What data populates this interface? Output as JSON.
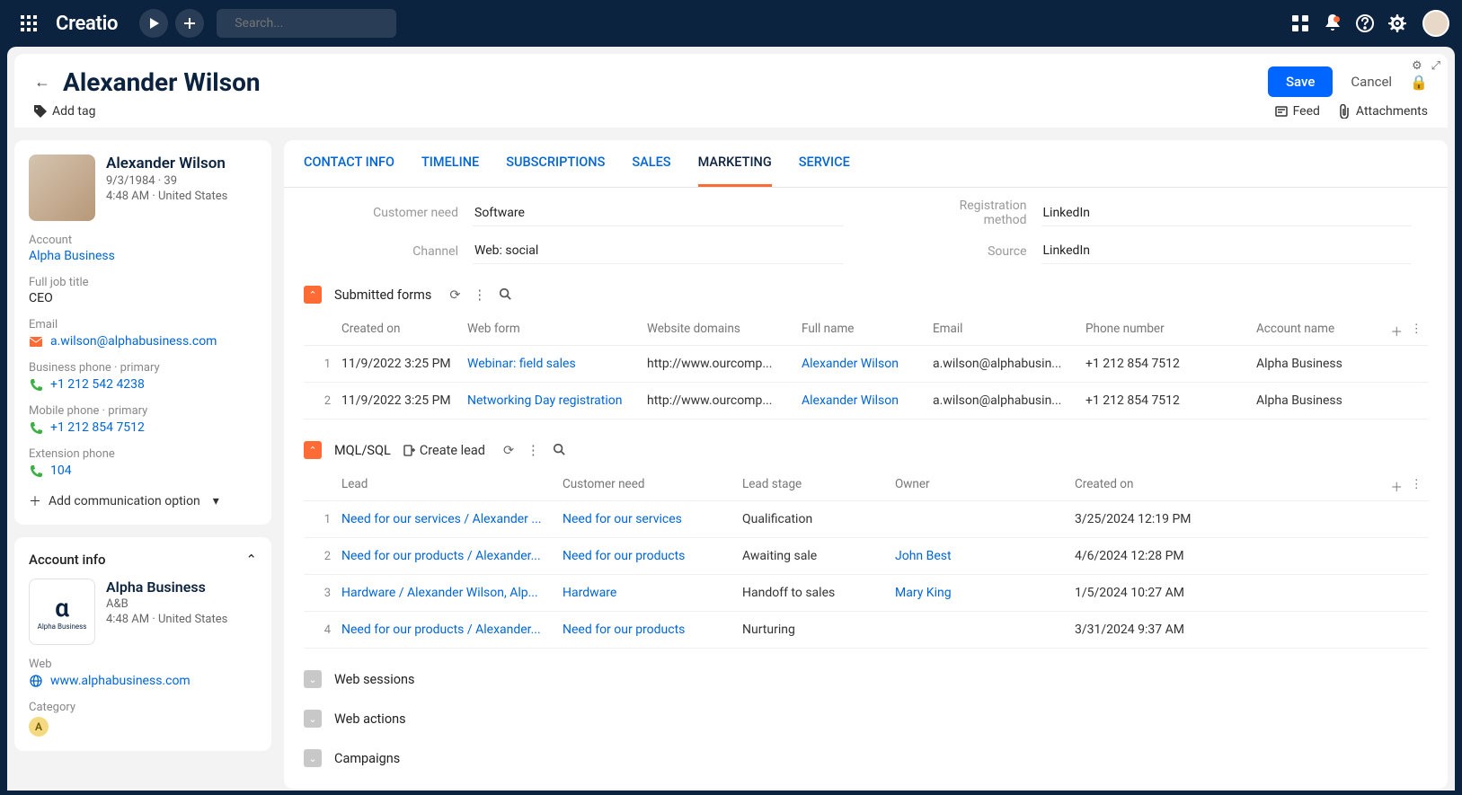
{
  "brand": "Creatio",
  "search_placeholder": "Search...",
  "header": {
    "title": "Alexander Wilson",
    "add_tag": "Add tag",
    "save": "Save",
    "cancel": "Cancel",
    "feed": "Feed",
    "attachments": "Attachments"
  },
  "contact": {
    "name": "Alexander Wilson",
    "dob_age": "9/3/1984 · 39",
    "time_loc": "4:48 AM · United States",
    "account_label": "Account",
    "account": "Alpha Business",
    "job_label": "Full job title",
    "job": "CEO",
    "email_label": "Email",
    "email": "a.wilson@alphabusiness.com",
    "biz_phone_label": "Business phone · primary",
    "biz_phone": "+1 212 542 4238",
    "mob_phone_label": "Mobile phone · primary",
    "mob_phone": "+1 212 854 7512",
    "ext_label": "Extension phone",
    "ext": "104",
    "add_comm": "Add communication option"
  },
  "account_info": {
    "title": "Account info",
    "name": "Alpha Business",
    "code": "A&B",
    "time_loc": "4:48 AM · United States",
    "web_label": "Web",
    "web": "www.alphabusiness.com",
    "cat_label": "Category",
    "cat": "A",
    "logo_sub": "Alpha Business"
  },
  "tabs": [
    "CONTACT INFO",
    "TIMELINE",
    "SUBSCRIPTIONS",
    "SALES",
    "MARKETING",
    "SERVICE"
  ],
  "active_tab": 4,
  "fields": {
    "customer_need_label": "Customer need",
    "customer_need": "Software",
    "channel_label": "Channel",
    "channel": "Web: social",
    "reg_method_label": "Registration method",
    "reg_method": "LinkedIn",
    "source_label": "Source",
    "source": "LinkedIn"
  },
  "forms": {
    "title": "Submitted forms",
    "headers": [
      "Created on",
      "Web form",
      "Website domains",
      "Full name",
      "Email",
      "Phone number",
      "Account name"
    ],
    "rows": [
      {
        "n": "1",
        "created": "11/9/2022 3:25 PM",
        "form": "Webinar: field sales",
        "domain": "http://www.ourcomp...",
        "name": "Alexander Wilson",
        "email": "a.wilson@alphabusin...",
        "phone": "+1 212 854 7512",
        "account": "Alpha Business"
      },
      {
        "n": "2",
        "created": "11/9/2022 3:25 PM",
        "form": "Networking Day registration",
        "domain": "http://www.ourcomp...",
        "name": "Alexander Wilson",
        "email": "a.wilson@alphabusin...",
        "phone": "+1 212 854 7512",
        "account": "Alpha Business"
      }
    ]
  },
  "leads": {
    "title": "MQL/SQL",
    "create": "Create lead",
    "headers": [
      "Lead",
      "Customer need",
      "Lead stage",
      "Owner",
      "Created on"
    ],
    "rows": [
      {
        "n": "1",
        "lead": "Need for our services / Alexander ...",
        "need": "Need for our services",
        "stage": "Qualification",
        "owner": "",
        "created": "3/25/2024 12:19 PM"
      },
      {
        "n": "2",
        "lead": "Need for our products / Alexander...",
        "need": "Need for our products",
        "stage": "Awaiting sale",
        "owner": "John Best",
        "created": "4/6/2024 12:28 PM"
      },
      {
        "n": "3",
        "lead": "Hardware / Alexander Wilson, Alp...",
        "need": "Hardware",
        "stage": "Handoff to sales",
        "owner": "Mary King",
        "created": "1/5/2024 10:27 AM"
      },
      {
        "n": "4",
        "lead": "Need for our products / Alexander...",
        "need": "Need for our products",
        "stage": "Nurturing",
        "owner": "",
        "created": "3/31/2024 9:37 AM"
      }
    ]
  },
  "collapsed": [
    "Web sessions",
    "Web actions",
    "Campaigns"
  ]
}
